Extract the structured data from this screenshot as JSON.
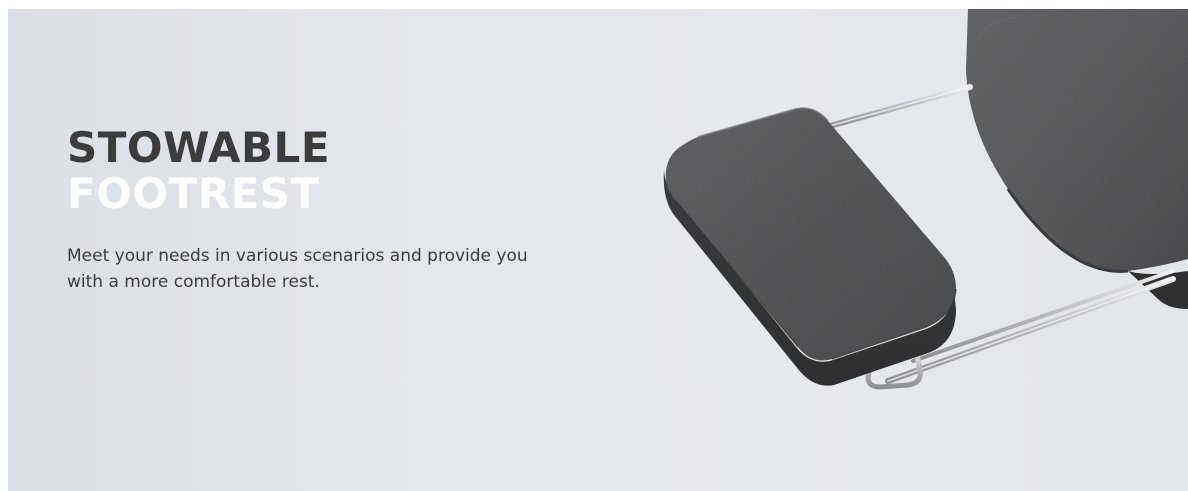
{
  "heading": {
    "line1": "STOWABLE",
    "line2": "FOOTREST"
  },
  "description": "Meet your needs in various scenarios and provide you with a more comfortable rest.",
  "colors": {
    "background": "#e3e6ea",
    "heading_dark": "#3c3c3c",
    "heading_light": "#ffffff",
    "body_text": "#3d3d3d",
    "cushion": "#454648",
    "metal_bar": "#c8c9cb"
  },
  "image": {
    "subject": "footrest-photo"
  }
}
